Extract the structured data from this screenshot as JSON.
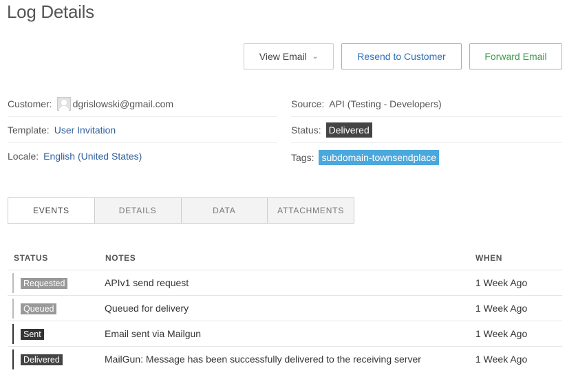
{
  "page": {
    "title": "Log Details"
  },
  "actions": {
    "view_email": "View Email",
    "view_email_chevron": "⌄",
    "resend": "Resend to Customer",
    "forward": "Forward Email"
  },
  "info": {
    "customer_label": "Customer:",
    "customer_value": "dgrislowski@gmail.com",
    "template_label": "Template:",
    "template_value": "User Invitation",
    "locale_label": "Locale:",
    "locale_value": "English (United States)",
    "source_label": "Source:",
    "source_value": "API (Testing - Developers)",
    "status_label": "Status:",
    "status_value": "Delivered",
    "tags_label": "Tags:",
    "tags_value": "subdomain-townsendplace"
  },
  "tabs": [
    {
      "label": "EVENTS",
      "active": true
    },
    {
      "label": "DETAILS",
      "active": false
    },
    {
      "label": "DATA",
      "active": false
    },
    {
      "label": "ATTACHMENTS",
      "active": false
    }
  ],
  "events_table": {
    "headers": {
      "status": "STATUS",
      "notes": "NOTES",
      "when": "WHEN"
    },
    "rows": [
      {
        "status": "Requested",
        "status_color": "#999999",
        "bar_color": "#bbbbbb",
        "notes": "APIv1 send request",
        "when": "1 Week Ago"
      },
      {
        "status": "Queued",
        "status_color": "#999999",
        "bar_color": "#bbbbbb",
        "notes": "Queued for delivery",
        "when": "1 Week Ago"
      },
      {
        "status": "Sent",
        "status_color": "#333333",
        "bar_color": "#333333",
        "notes": "Email sent via Mailgun",
        "when": "1 Week Ago"
      },
      {
        "status": "Delivered",
        "status_color": "#444444",
        "bar_color": "#333333",
        "notes": "MailGun: Message has been successfully delivered to the receiving server",
        "when": "1 Week Ago"
      }
    ]
  },
  "colors": {
    "resend_accent": "#2f6fb5",
    "forward_accent": "#3d9a4a",
    "tag_bg": "#4aa8dc",
    "link": "#2f5f9e"
  }
}
